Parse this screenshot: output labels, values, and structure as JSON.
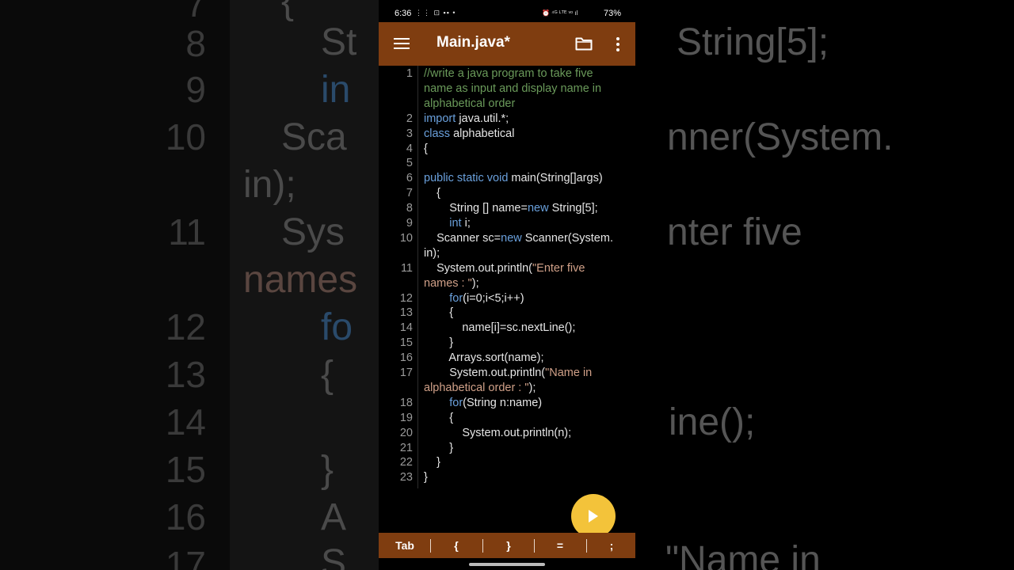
{
  "statusbar": {
    "time": "6:36",
    "left_icons": "⋮⋮ ⊡ ▪▪ •",
    "right_icons": "⏰ ⁴ᴳ ᴸᵀᴱ ᵛᵒ ıl",
    "battery": "73%"
  },
  "appbar": {
    "title": "Main.java*",
    "menu_icon": "hamburger-menu",
    "folder_icon": "folder",
    "more_icon": "more-vertical"
  },
  "code_lines": [
    {
      "num": "1",
      "segments": [
        {
          "t": "//write a java program to take five",
          "c": "comment"
        }
      ]
    },
    {
      "num": "",
      "segments": [
        {
          "t": "name as input and display name in",
          "c": "comment"
        }
      ]
    },
    {
      "num": "",
      "segments": [
        {
          "t": "alphabetical order",
          "c": "comment"
        }
      ]
    },
    {
      "num": "2",
      "segments": [
        {
          "t": "import",
          "c": "kw"
        },
        {
          "t": " java.util.*;",
          "c": "plain"
        }
      ]
    },
    {
      "num": "3",
      "segments": [
        {
          "t": "class",
          "c": "kw"
        },
        {
          "t": " alphabetical",
          "c": "plain"
        }
      ]
    },
    {
      "num": "4",
      "segments": [
        {
          "t": "{",
          "c": "plain"
        }
      ]
    },
    {
      "num": "5",
      "segments": []
    },
    {
      "num": "6",
      "segments": [
        {
          "t": "public static void",
          "c": "kw"
        },
        {
          "t": " main(String[]args)",
          "c": "plain"
        }
      ]
    },
    {
      "num": "7",
      "segments": [
        {
          "t": "    {",
          "c": "plain"
        }
      ]
    },
    {
      "num": "8",
      "segments": [
        {
          "t": "        String [] name=",
          "c": "plain"
        },
        {
          "t": "new",
          "c": "kw"
        },
        {
          "t": " String[5];",
          "c": "plain"
        }
      ]
    },
    {
      "num": "9",
      "segments": [
        {
          "t": "        ",
          "c": "plain"
        },
        {
          "t": "int",
          "c": "kw"
        },
        {
          "t": " i;",
          "c": "plain"
        }
      ]
    },
    {
      "num": "10",
      "segments": [
        {
          "t": "    Scanner sc=",
          "c": "plain"
        },
        {
          "t": "new",
          "c": "kw"
        },
        {
          "t": " Scanner(System.",
          "c": "plain"
        }
      ]
    },
    {
      "num": "",
      "segments": [
        {
          "t": "in);",
          "c": "plain"
        }
      ]
    },
    {
      "num": "11",
      "segments": [
        {
          "t": "    System.out.println(",
          "c": "plain"
        },
        {
          "t": "\"Enter five",
          "c": "str"
        }
      ]
    },
    {
      "num": "",
      "segments": [
        {
          "t": "names : \"",
          "c": "str"
        },
        {
          "t": ");",
          "c": "plain"
        }
      ]
    },
    {
      "num": "12",
      "segments": [
        {
          "t": "        ",
          "c": "plain"
        },
        {
          "t": "for",
          "c": "kw"
        },
        {
          "t": "(i=0;i<5;i++)",
          "c": "plain"
        }
      ]
    },
    {
      "num": "13",
      "segments": [
        {
          "t": "        {",
          "c": "plain"
        }
      ]
    },
    {
      "num": "14",
      "segments": [
        {
          "t": "            name[i]=sc.nextLine();",
          "c": "plain"
        }
      ]
    },
    {
      "num": "15",
      "segments": [
        {
          "t": "        }",
          "c": "plain"
        }
      ]
    },
    {
      "num": "16",
      "segments": [
        {
          "t": "        Arrays.sort(name);",
          "c": "plain"
        }
      ]
    },
    {
      "num": "17",
      "segments": [
        {
          "t": "        System.out.println(",
          "c": "plain"
        },
        {
          "t": "\"Name in",
          "c": "str"
        }
      ]
    },
    {
      "num": "",
      "segments": [
        {
          "t": "alphabetical order : \"",
          "c": "str"
        },
        {
          "t": ");",
          "c": "plain"
        }
      ]
    },
    {
      "num": "18",
      "segments": [
        {
          "t": "        ",
          "c": "plain"
        },
        {
          "t": "for",
          "c": "kw"
        },
        {
          "t": "(String n:name)",
          "c": "plain"
        }
      ]
    },
    {
      "num": "19",
      "segments": [
        {
          "t": "        {",
          "c": "plain"
        }
      ]
    },
    {
      "num": "20",
      "segments": [
        {
          "t": "            System.out.println(n);",
          "c": "plain"
        }
      ]
    },
    {
      "num": "21",
      "segments": [
        {
          "t": "        }",
          "c": "plain"
        }
      ]
    },
    {
      "num": "22",
      "segments": [
        {
          "t": "    }",
          "c": "plain"
        }
      ]
    },
    {
      "num": "23",
      "segments": [
        {
          "t": "}",
          "c": "plain"
        }
      ]
    }
  ],
  "fab": {
    "icon": "play"
  },
  "keybar": {
    "keys": [
      "Tab",
      "{",
      "}",
      "=",
      ";"
    ]
  },
  "background": {
    "left_numbers": [
      "7",
      "8",
      "9",
      "10",
      "11",
      "12",
      "13",
      "14",
      "15",
      "16",
      "17"
    ],
    "left_text": [
      {
        "t": "{",
        "c": "plain"
      },
      {
        "t": "St",
        "c": "plain"
      },
      {
        "t": "in",
        "c": "kw"
      },
      {
        "t": "Sca",
        "c": "plain"
      },
      {
        "t": "in);",
        "c": "plain"
      },
      {
        "t": "Sys",
        "c": "plain"
      },
      {
        "t": "names",
        "c": "str"
      },
      {
        "t": "fo",
        "c": "kw"
      },
      {
        "t": "{",
        "c": "plain"
      },
      {
        "t": "}",
        "c": "plain"
      },
      {
        "t": "A",
        "c": "plain"
      },
      {
        "t": "S",
        "c": "plain"
      }
    ],
    "right_text": [
      {
        "t": "String[5];",
        "c": "plain"
      },
      {
        "t": "nner(System.",
        "c": "plain"
      },
      {
        "t": "nter five",
        "c": "str"
      },
      {
        "t": "ine();",
        "c": "plain"
      },
      {
        "t": "\"Name in",
        "c": "str"
      }
    ]
  }
}
